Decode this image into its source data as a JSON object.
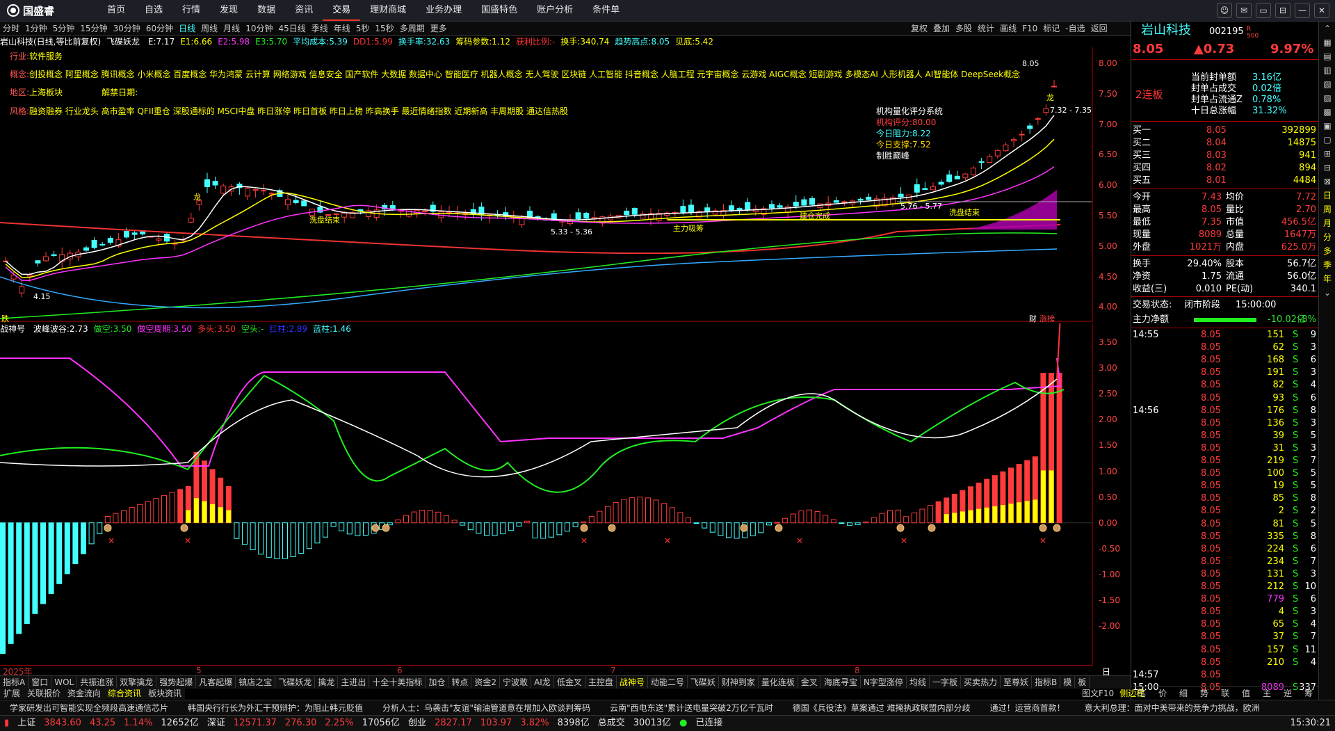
{
  "app": {
    "logo": "国盛睿"
  },
  "nav": [
    "首页",
    "自选",
    "行情",
    "发现",
    "数据",
    "资讯",
    "交易",
    "理财商城",
    "业务办理",
    "国盛特色",
    "账户分析",
    "条件单"
  ],
  "nav_active": "交易",
  "window_buttons": [
    "☺",
    "✉",
    "▭",
    "⊟",
    "—",
    "✕"
  ],
  "periods": [
    "分时",
    "1分钟",
    "5分钟",
    "15分钟",
    "30分钟",
    "60分钟",
    "日线",
    "周线",
    "月线",
    "10分钟",
    "45日线",
    "季线",
    "年线",
    "5秒",
    "15秒",
    "多周期",
    "更多"
  ],
  "period_active": "日线",
  "right_tools": [
    "复权",
    "叠加",
    "多股",
    "统计",
    "画线",
    "F10",
    "标记",
    "-自选",
    "返回"
  ],
  "stock": {
    "name": "岩山科技",
    "code": "002195",
    "market": "R",
    "market_sub": "500",
    "price": "8.05",
    "change": "▲0.73",
    "pct": "9.97%",
    "streak": "2连板"
  },
  "header": {
    "title": "岩山科技(日线,等比前复权)",
    "ind": "飞碟妖龙",
    "items": [
      {
        "k": "E:",
        "v": "7.17",
        "c": "#fff"
      },
      {
        "k": "E1:",
        "v": "6.66",
        "c": "#ff0"
      },
      {
        "k": "E2:",
        "v": "5.98",
        "c": "#f3f"
      },
      {
        "k": "E3:",
        "v": "5.70",
        "c": "#2e2"
      },
      {
        "k": "平均成本:",
        "v": "5.39",
        "c": "#4ff"
      },
      {
        "k": "DD1:",
        "v": "5.99",
        "c": "#f33"
      },
      {
        "k": "换手率:",
        "v": "32.63",
        "c": "#4ff"
      },
      {
        "k": "筹码参数:",
        "v": "1.12",
        "c": "#ff0"
      },
      {
        "k": "获利比例:",
        "v": "-",
        "c": "#f33"
      },
      {
        "k": "换手:",
        "v": "340.74",
        "c": "#ff0"
      },
      {
        "k": "趋势高点:",
        "v": "8.05",
        "c": "#4ff"
      },
      {
        "k": "见底:",
        "v": "5.42",
        "c": "#ff0"
      }
    ]
  },
  "info_lines": {
    "industry_label": "行业:",
    "industry": "软件服务",
    "concept_label": "概念:",
    "concept": "创投概念 阿里概念 腾讯概念 小米概念 百度概念 华为鸿蒙 云计算 网络游戏 信息安全 国产软件 大数据 数据中心 智能医疗 机器人概念 无人驾驶 区块链 人工智能 抖音概念 人脑工程 元宇宙概念 云游戏 AIGC概念 短剧游戏 多模态AI 人形机器人 AI智能体 DeepSeek概念",
    "region_label": "地区:",
    "region": "上海板块",
    "unlock_label": "解禁日期:",
    "style_label": "风格:",
    "style": "融资融券 行业龙头 高市盈率 QFII重仓 深股通标的 MSCI中盘 昨日涨停 昨日首板 昨日上榜 昨高换手 最近情绪指数 近期新高 丰周期股 通达信热股"
  },
  "score": {
    "title": "机构量化评分系统",
    "score_label": "机构评分:",
    "score": "80.00",
    "res_label": "今日阻力:",
    "res": "8.22",
    "sup_label": "今日支撑:",
    "sup": "7.52",
    "tag": "制胜巅峰"
  },
  "annotations": {
    "wash1": "洗盘结束",
    "wash2": "洗盘结束",
    "accum": "主力吸筹",
    "build": "建仓完成",
    "dragon": "龙",
    "hi": "8.05",
    "range": "7.32 - 7.35",
    "low": "4.15",
    "mid": "5.33 - 5.36",
    "mid2": "5.76 - 5.77"
  },
  "axis_main": [
    "8.00",
    "7.50",
    "7.00",
    "6.50",
    "6.00",
    "5.50",
    "5.00",
    "4.50",
    "4.00"
  ],
  "axis_sub": [
    "3.50",
    "3.00",
    "2.50",
    "2.00",
    "1.50",
    "1.00",
    "0.50",
    "0.00",
    "-0.50",
    "-1.00",
    "-1.50",
    "-2.00"
  ],
  "main_footer": {
    "left": "跌",
    "r1": "财",
    "r2": "涨榜"
  },
  "sub_head": {
    "name": "战神号",
    "items": [
      {
        "k": "波峰波谷:",
        "v": "2.73",
        "c": "#fff"
      },
      {
        "k": "做空:",
        "v": "3.50",
        "c": "#2e2"
      },
      {
        "k": "做空周期:",
        "v": "3.50",
        "c": "#f3f"
      },
      {
        "k": "多头:",
        "v": "3.50",
        "c": "#f33"
      },
      {
        "k": "空头:",
        "v": "-",
        "c": "#2e2"
      },
      {
        "k": "红柱:",
        "v": "2.89",
        "c": "#33f"
      },
      {
        "k": "蓝柱:",
        "v": "1.46",
        "c": "#4ff"
      }
    ]
  },
  "xaxis": {
    "year": "2025年",
    "m5": "5",
    "m6": "6",
    "m7": "7",
    "m8": "8",
    "period": "日线"
  },
  "ind_tabs": [
    "指标A",
    "窗口",
    "WOL",
    "共振追涨",
    "双擎擒龙",
    "强势起爆",
    "凡客起爆",
    "镇店之宝",
    "飞碟妖龙",
    "擒龙",
    "主进出",
    "十全十美指标",
    "加仓",
    "转点",
    "资金2",
    "宁波敢",
    "AI龙",
    "低金叉",
    "主控盘",
    "战神号",
    "动能二号",
    "飞碟妖",
    "财神到家",
    "量化连板",
    "金叉",
    "海底寻宝",
    "N字型涨停",
    "均线",
    "一字板",
    "买卖热力",
    "至尊妖",
    "指标B",
    "模",
    "板"
  ],
  "ind_active": "战神号",
  "bottom_tabs": [
    "扩展",
    "关联报价",
    "资金流向",
    "综合资讯",
    "板块资讯"
  ],
  "bottom_active": "综合资讯",
  "right_bottom_tabs": [
    "图文F10",
    "侧边栏"
  ],
  "news": [
    "学家研发出可智能实现全频段高速通信芯片",
    "韩国央行行长为外汇干预辩护：为阻止韩元贬值",
    "分析人士：乌袭击\"友谊\"输油管道意在增加入欧谈判筹码",
    "云南\"西电东送\"累计送电量突破2万亿千瓦时",
    "德国《兵役法》草案通过 难掩执政联盟内部分歧",
    "通过！运营商首款！",
    "意大利总理：面对中美带来的竞争力挑战，欧洲"
  ],
  "index_bar": [
    {
      "n": "上证",
      "v": "3843.60",
      "c": "43.25",
      "p": "1.14%",
      "a": "12652亿"
    },
    {
      "n": "深证",
      "v": "12571.37",
      "c": "276.30",
      "p": "2.25%",
      "a": "17056亿"
    },
    {
      "n": "创业",
      "v": "2827.17",
      "c": "103.97",
      "p": "3.82%",
      "a": "8398亿"
    }
  ],
  "index_total": {
    "label": "总成交",
    "v": "30013亿"
  },
  "conn": "已连接",
  "clock": "15:30:21",
  "seal": [
    {
      "k": "当前封单额",
      "v": "3.16亿"
    },
    {
      "k": "封单占成交",
      "v": "0.02倍"
    },
    {
      "k": "封单占流通Z",
      "v": "0.78%"
    },
    {
      "k": "十日总涨幅",
      "v": "31.32%"
    }
  ],
  "bids": [
    {
      "k": "买一",
      "p": "8.05",
      "v": "392899"
    },
    {
      "k": "买二",
      "p": "8.04",
      "v": "14875"
    },
    {
      "k": "买三",
      "p": "8.03",
      "v": "941"
    },
    {
      "k": "买四",
      "p": "8.02",
      "v": "894"
    },
    {
      "k": "买五",
      "p": "8.01",
      "v": "4484"
    }
  ],
  "quote": [
    {
      "k1": "今开",
      "v1": "7.43",
      "k2": "均价",
      "v2": "7.72"
    },
    {
      "k1": "最高",
      "v1": "8.05",
      "k2": "量比",
      "v2": "2.70"
    },
    {
      "k1": "最低",
      "v1": "7.35",
      "k2": "市值",
      "v2": "456.5亿"
    },
    {
      "k1": "现量",
      "v1": "8089",
      "k2": "总量",
      "v2": "1647万"
    },
    {
      "k1": "外盘",
      "v1": "1021万",
      "k2": "内盘",
      "v2": "625.0万"
    }
  ],
  "quote2": [
    {
      "k1": "换手",
      "v1": "29.40%",
      "k2": "股本",
      "v2": "56.7亿"
    },
    {
      "k1": "净资",
      "v1": "1.75",
      "k2": "流通",
      "v2": "56.0亿"
    },
    {
      "k1": "收益(三)",
      "v1": "0.010",
      "k2": "PE(动)",
      "v2": "340.1"
    }
  ],
  "status": {
    "label": "交易状态:",
    "v": "闭市阶段",
    "t": "15:00:00"
  },
  "netflow": {
    "label": "主力净额",
    "v": "-10.02亿",
    "p": "-8%"
  },
  "ticks": [
    {
      "t": "14:55",
      "p": "8.05",
      "v": "151",
      "s": "S",
      "n": "9"
    },
    {
      "t": "",
      "p": "8.05",
      "v": "62",
      "s": "S",
      "n": "3"
    },
    {
      "t": "",
      "p": "8.05",
      "v": "168",
      "s": "S",
      "n": "6"
    },
    {
      "t": "",
      "p": "8.05",
      "v": "191",
      "s": "S",
      "n": "3"
    },
    {
      "t": "",
      "p": "8.05",
      "v": "82",
      "s": "S",
      "n": "4"
    },
    {
      "t": "",
      "p": "8.05",
      "v": "93",
      "s": "S",
      "n": "6"
    },
    {
      "t": "14:56",
      "p": "8.05",
      "v": "176",
      "s": "S",
      "n": "8"
    },
    {
      "t": "",
      "p": "8.05",
      "v": "136",
      "s": "S",
      "n": "3"
    },
    {
      "t": "",
      "p": "8.05",
      "v": "39",
      "s": "S",
      "n": "5"
    },
    {
      "t": "",
      "p": "8.05",
      "v": "31",
      "s": "S",
      "n": "3"
    },
    {
      "t": "",
      "p": "8.05",
      "v": "219",
      "s": "S",
      "n": "7"
    },
    {
      "t": "",
      "p": "8.05",
      "v": "100",
      "s": "S",
      "n": "5"
    },
    {
      "t": "",
      "p": "8.05",
      "v": "19",
      "s": "S",
      "n": "5"
    },
    {
      "t": "",
      "p": "8.05",
      "v": "85",
      "s": "S",
      "n": "8"
    },
    {
      "t": "",
      "p": "8.05",
      "v": "2",
      "s": "S",
      "n": "2"
    },
    {
      "t": "",
      "p": "8.05",
      "v": "81",
      "s": "S",
      "n": "5"
    },
    {
      "t": "",
      "p": "8.05",
      "v": "335",
      "s": "S",
      "n": "8"
    },
    {
      "t": "",
      "p": "8.05",
      "v": "224",
      "s": "S",
      "n": "6"
    },
    {
      "t": "",
      "p": "8.05",
      "v": "234",
      "s": "S",
      "n": "7"
    },
    {
      "t": "",
      "p": "8.05",
      "v": "131",
      "s": "S",
      "n": "3"
    },
    {
      "t": "",
      "p": "8.05",
      "v": "212",
      "s": "S",
      "n": "10"
    },
    {
      "t": "",
      "p": "8.05",
      "v": "779",
      "s": "S",
      "n": "6"
    },
    {
      "t": "",
      "p": "8.05",
      "v": "4",
      "s": "S",
      "n": "3"
    },
    {
      "t": "",
      "p": "8.05",
      "v": "65",
      "s": "S",
      "n": "4"
    },
    {
      "t": "",
      "p": "8.05",
      "v": "37",
      "s": "S",
      "n": "7"
    },
    {
      "t": "",
      "p": "8.05",
      "v": "157",
      "s": "S",
      "n": "11"
    },
    {
      "t": "",
      "p": "8.05",
      "v": "210",
      "s": "S",
      "n": "4"
    },
    {
      "t": "14:57",
      "p": "8.05",
      "v": "",
      "s": "",
      "n": ""
    },
    {
      "t": "15:00",
      "p": "8.05",
      "v": "8089",
      "s": "S",
      "n": "337"
    }
  ],
  "side_tabs": [
    "笔",
    "价",
    "细",
    "势",
    "联",
    "值",
    "主",
    "逆",
    "筹"
  ],
  "rscroll": [
    "⌃",
    "▦",
    "▤",
    "▥",
    "▧",
    "▨",
    "▩",
    "▣",
    "▢",
    "⊞",
    "⊟",
    "⊠",
    "日",
    "周",
    "月",
    "分",
    "多",
    "季",
    "年",
    "⌄"
  ],
  "colors": {
    "up": "#ff3b3b",
    "down": "#2ee02e",
    "cyan": "#44ffff",
    "magenta": "#ff33ff",
    "yellow": "#ffff00"
  }
}
